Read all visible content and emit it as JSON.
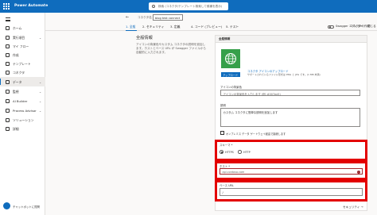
{
  "app": {
    "title": "Power Automate"
  },
  "search": {
    "placeholder": "検索 (コネクタ/テンプレート検索して候補を表示)"
  },
  "sidebar": {
    "items": [
      {
        "label": "ホーム",
        "chevron": ""
      },
      {
        "label": "実行項目",
        "chevron": "⌄"
      },
      {
        "label": "マイ フロー",
        "chevron": ""
      },
      {
        "label": "作成",
        "chevron": ""
      },
      {
        "label": "テンプレート",
        "chevron": ""
      },
      {
        "label": "コネクタ",
        "chevron": ""
      },
      {
        "label": "データ",
        "chevron": "⌄"
      },
      {
        "label": "監視",
        "chevron": "⌄"
      },
      {
        "label": "AI Builder",
        "chevron": "⌄"
      },
      {
        "label": "Process Advisor",
        "chevron": "⌄"
      },
      {
        "label": "ソリューション",
        "chevron": ""
      },
      {
        "label": "詳細",
        "chevron": ""
      }
    ],
    "chatbot_label": "チャットボットに質問"
  },
  "command": {
    "back_glyph": "←",
    "connector_label": "コネクタ名",
    "connector_value": "blog test connect"
  },
  "tabs": [
    {
      "label": "1. 全般"
    },
    {
      "label": "2. セキュリティ"
    },
    {
      "label": "3. 定義"
    },
    {
      "label": "4. コード (プレビュー)"
    },
    {
      "label": "5. テスト"
    }
  ],
  "toolbar": {
    "swagger_label": "Swagger エディター",
    "save_label": "コネクタの作成",
    "close_label": "閉じる"
  },
  "info": {
    "heading": "全般情報",
    "text": "アイコンの背景色やカスタム コネクタの説明を追加します。ホストとベース URL が Swagger ファイルから自動的に入力されます。"
  },
  "card": {
    "header": "全般情報",
    "link_text": "コネクタ アイコンのアップロード",
    "hint_text": "サポートされているファイル形式は PNG と JPG です。(1 MB 未満)",
    "upload_button": "アップロード",
    "bg_color_label": "アイコンの背景色",
    "bg_color_placeholder": "アイコンの背景色を入力します (例: #007ee5)",
    "desc_label": "説明",
    "desc_value": "カスタム コネクタに簡単な説明を追加します",
    "checkbox_label": "オンプレミス データ ゲートウェイ経由で接続します"
  },
  "scheme": {
    "label": "スキーマ *",
    "options": [
      "HTTPS",
      "HTTP"
    ],
    "selected": "HTTPS"
  },
  "host": {
    "label": "ホスト *",
    "placeholder": "api.contoso.com",
    "error_glyph": "!"
  },
  "base_url": {
    "label": "ベース URL",
    "value": "/"
  },
  "footer": {
    "next_label": "セキュリティ →"
  },
  "colors": {
    "accent": "#0f6cbd",
    "highlight": "#e30000",
    "icon_bg": "#36a04a"
  }
}
